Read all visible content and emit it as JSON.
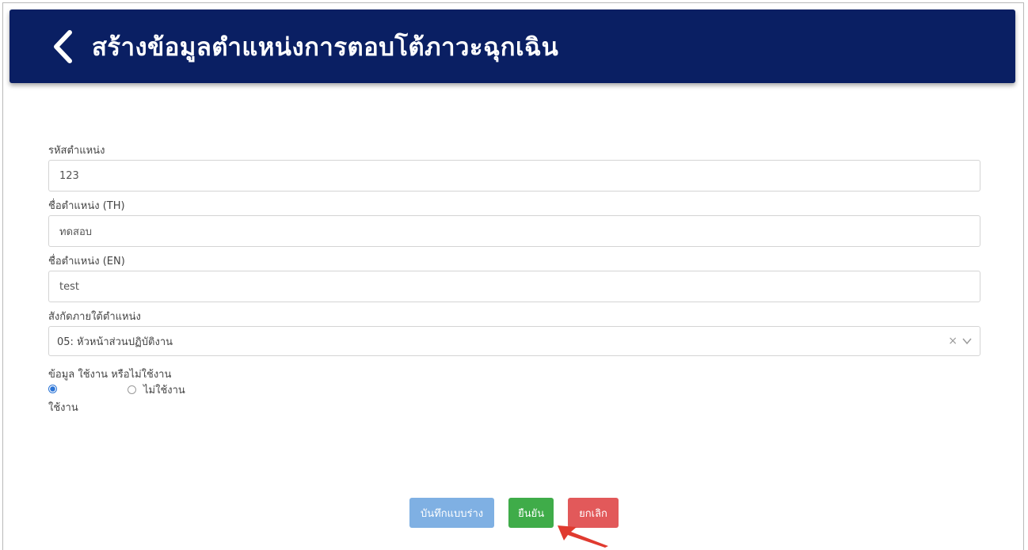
{
  "header": {
    "title": "สร้างข้อมูลตำแหน่งการตอบโต้ภาวะฉุกเฉิน"
  },
  "form": {
    "position_code": {
      "label": "รหัสตำแหน่ง",
      "value": "123"
    },
    "name_th": {
      "label": "ชื่อตำแหน่ง (TH)",
      "value": "ทดสอบ"
    },
    "name_en": {
      "label": "ชื่อตำแหน่ง (EN)",
      "value": "test"
    },
    "parent_position": {
      "label": "สังกัดภายใต้ตำแหน่ง",
      "selected": "05: หัวหน้าส่วนปฏิบัติงาน",
      "clear_symbol": "×"
    },
    "status": {
      "label": "ข้อมูล ใช้งาน หรือไม่ใช้งาน",
      "options": [
        {
          "label": "ใช้งาน",
          "checked": true
        },
        {
          "label": "ไม่ใช้งาน",
          "checked": false
        }
      ]
    }
  },
  "buttons": {
    "draft": "บันทึกแบบร่าง",
    "confirm": "ยืนยัน",
    "cancel": "ยกเลิก"
  },
  "colors": {
    "header_bg": "#0a1f63",
    "draft_button": "#7fb0e3",
    "confirm_button": "#3fac49",
    "cancel_button": "#e2595a",
    "pointer_arrow": "#e03a2f"
  },
  "icons": {
    "back": "chevron-left-icon",
    "dropdown": "chevron-down-icon",
    "clear": "close-icon",
    "annotation": "pointer-arrow-icon"
  }
}
